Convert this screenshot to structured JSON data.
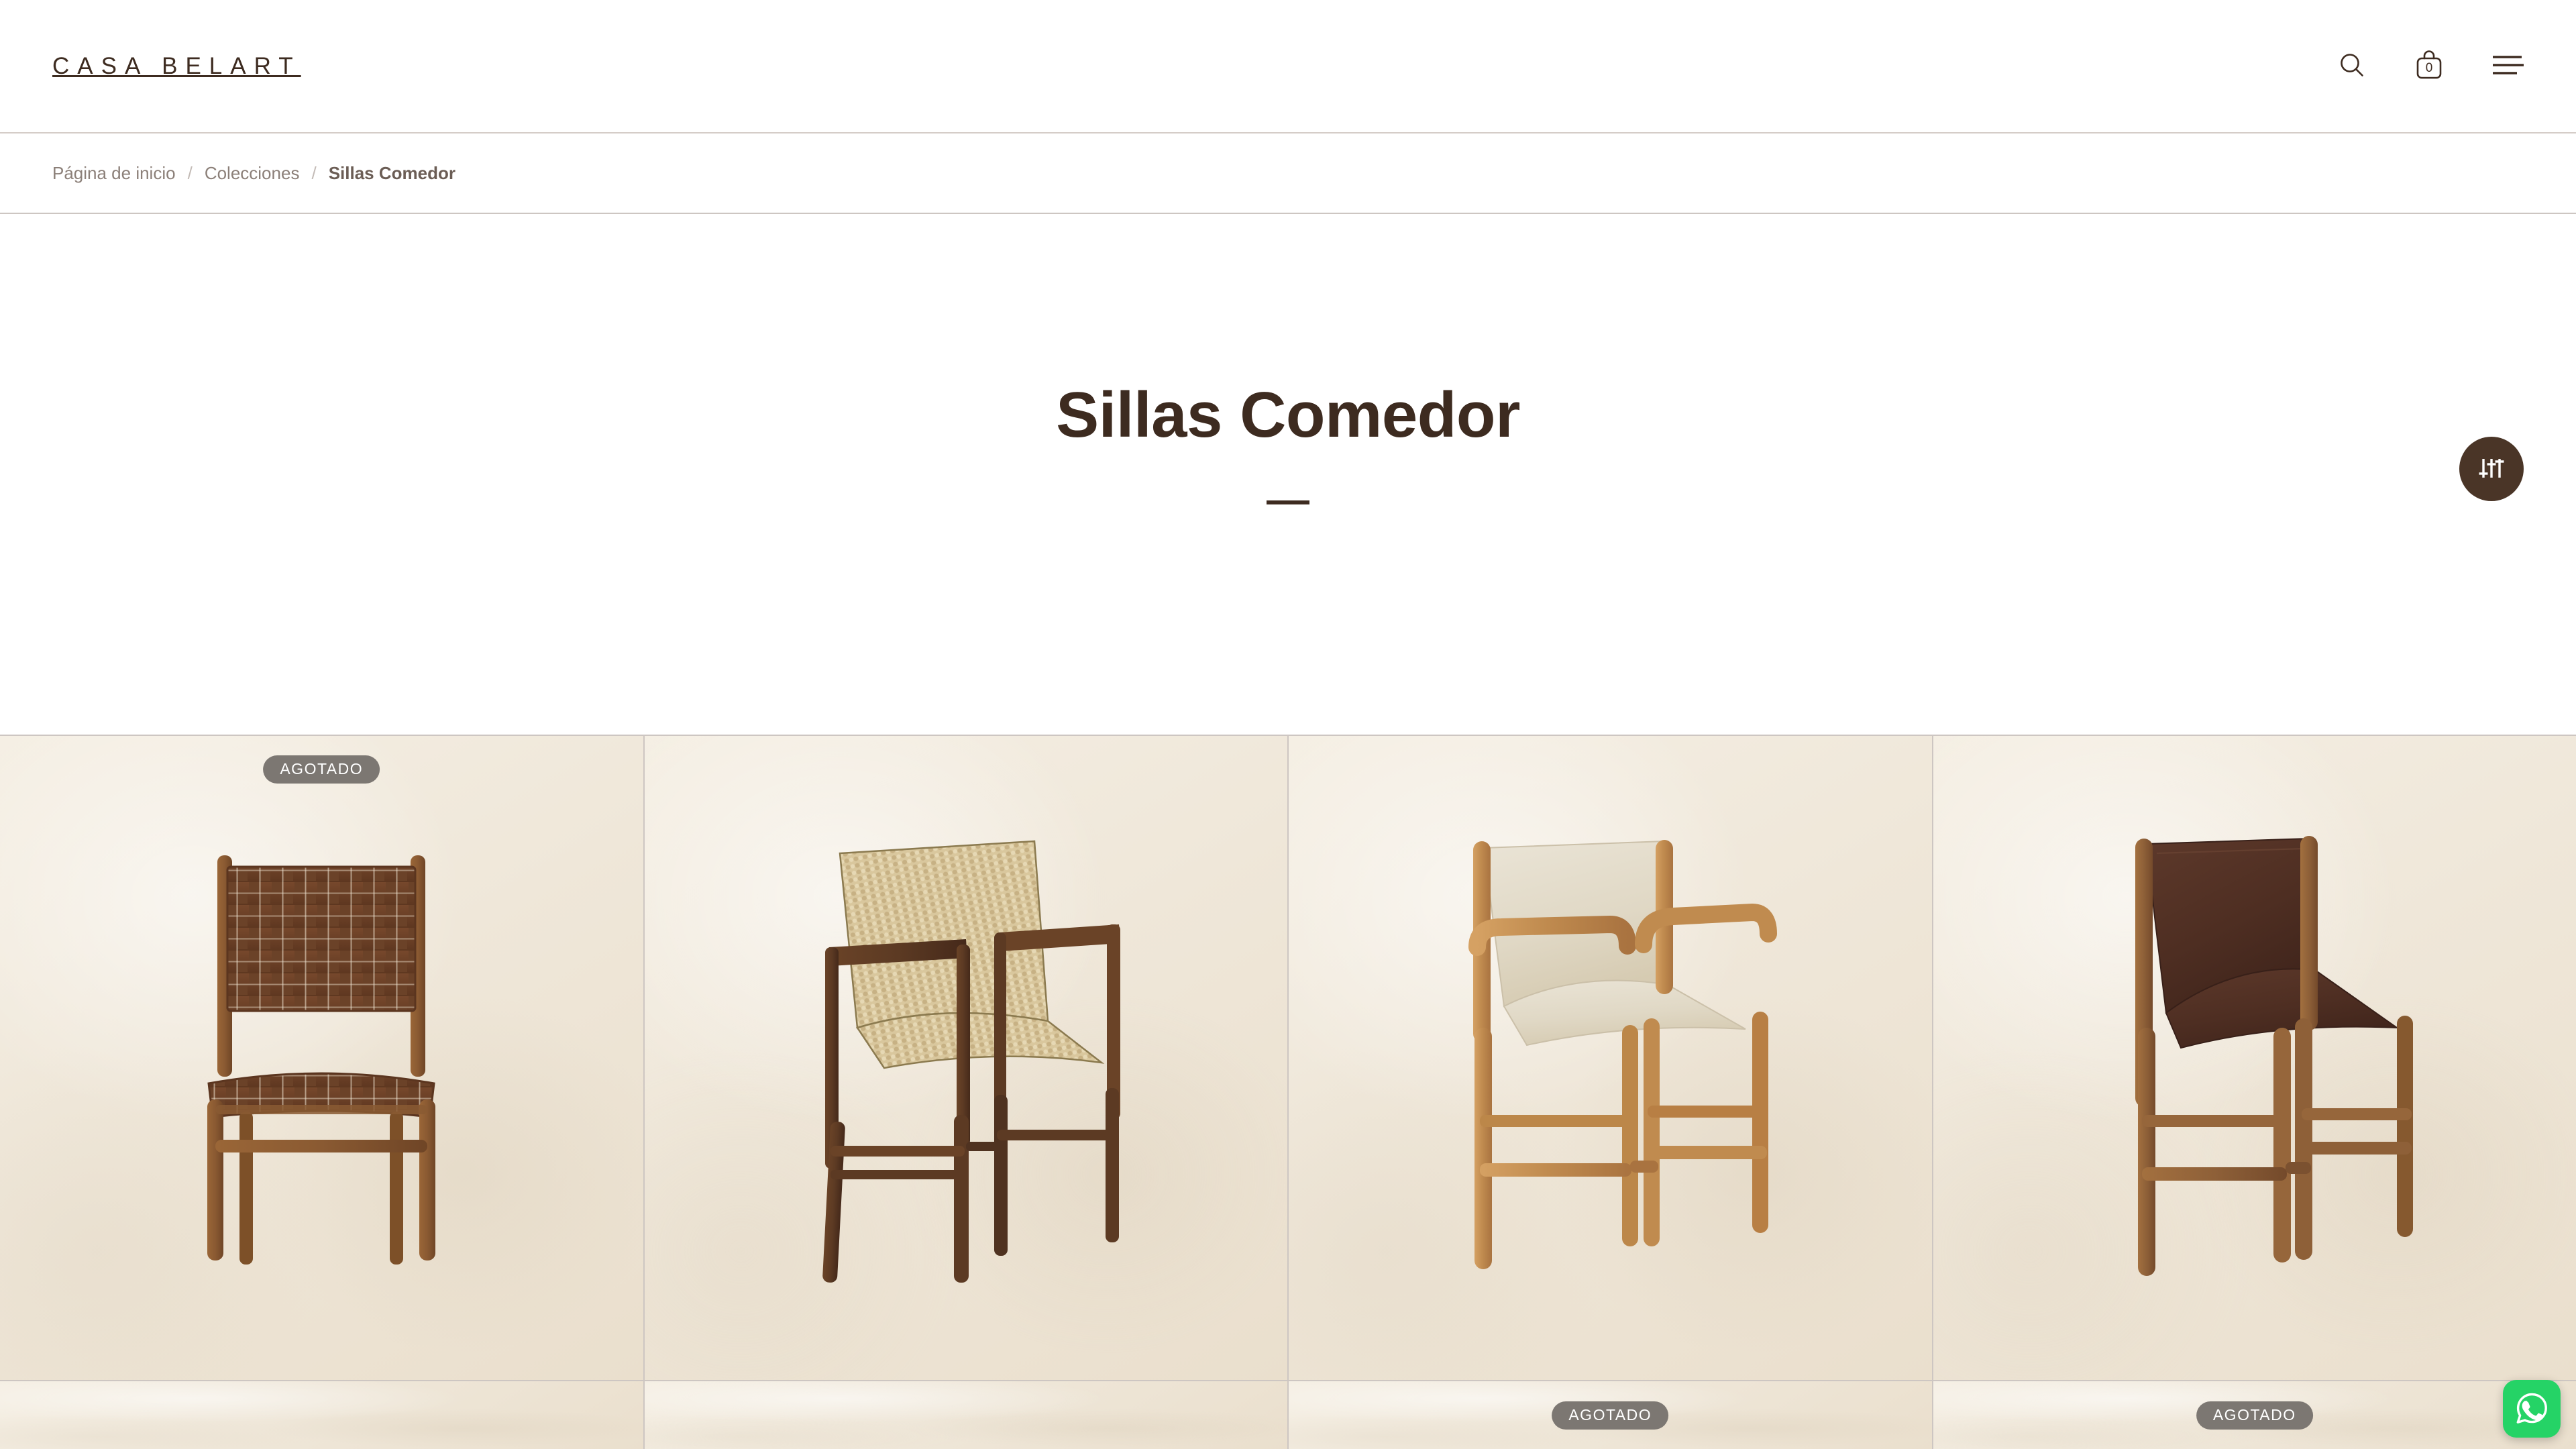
{
  "header": {
    "logo": "CASA BELART",
    "search_label": "Buscar",
    "cart_label": "Carrito",
    "cart_count": "0",
    "menu_label": "Menú"
  },
  "breadcrumb": {
    "home": "Página de inicio",
    "separator": "/",
    "collections": "Colecciones",
    "current": "Sillas Comedor"
  },
  "hero": {
    "title": "Sillas Comedor",
    "filter_label": "Filtros"
  },
  "colors": {
    "brand_brown": "#3d2b20",
    "fab_brown": "#4a3527",
    "badge_gray": "#7c7772",
    "tile_cream": "#f2ebdf",
    "divider": "#cdc6c2",
    "whatsapp_green": "#25d366",
    "breadcrumb_text": "#8b7f78"
  },
  "products": {
    "sold_out_label": "AGOTADO",
    "row1": [
      {
        "name": "silla-cuero-trenzado",
        "sold_out": true,
        "frame": "#8a5a32",
        "material": "#6b4228",
        "type": "woven-leather-side-chair"
      },
      {
        "name": "silla-cuerda-natural",
        "sold_out": false,
        "frame": "#5c3a23",
        "material": "#d9c79d",
        "type": "woven-rope-armchair"
      },
      {
        "name": "silla-cuero-crema",
        "sold_out": false,
        "frame": "#c08b4f",
        "material": "#e6dfd0",
        "type": "cream-leather-armchair"
      },
      {
        "name": "silla-cuero-chocolate",
        "sold_out": false,
        "frame": "#8e6038",
        "material": "#4a2c20",
        "type": "brown-leather-side-chair"
      }
    ],
    "row2": [
      {
        "name": "producto-5",
        "sold_out": false
      },
      {
        "name": "producto-6",
        "sold_out": false
      },
      {
        "name": "producto-7",
        "sold_out": true
      },
      {
        "name": "producto-8",
        "sold_out": true
      }
    ]
  },
  "whatsapp": {
    "label": "WhatsApp"
  }
}
